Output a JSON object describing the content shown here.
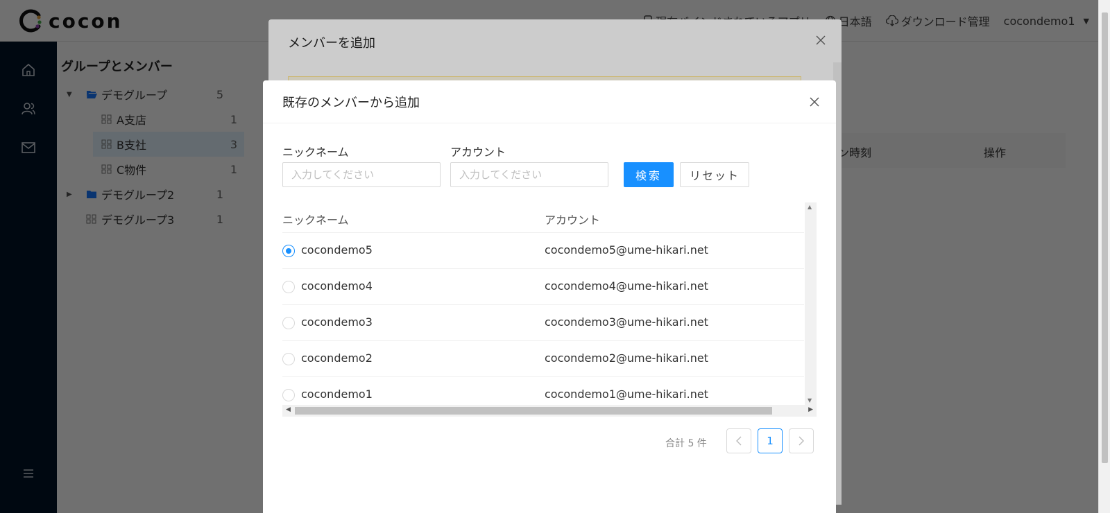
{
  "app": {
    "logo_text": "cocon",
    "header_links": [
      "現在バインドされているアプリ",
      "日本語",
      "ダウンロード管理"
    ],
    "user": "cocondemo1"
  },
  "tree": {
    "title": "グループとメンバー",
    "items": [
      {
        "label": "デモグループ",
        "count": "5"
      },
      {
        "label": "A支店",
        "count": "1"
      },
      {
        "label": "B支社",
        "count": "3"
      },
      {
        "label": "C物件",
        "count": "1"
      },
      {
        "label": "デモグループ2",
        "count": "1"
      },
      {
        "label": "デモグループ3",
        "count": "1"
      }
    ]
  },
  "background_table": {
    "col_login": "イン時刻",
    "col_ops": "操作"
  },
  "modal_add_member": {
    "title": "メンバーを追加"
  },
  "modal_existing": {
    "title": "既存のメンバーから追加",
    "nickname_label": "ニックネーム",
    "account_label": "アカウント",
    "nickname_placeholder": "入力してください",
    "account_placeholder": "入力してください",
    "search_label": "検索",
    "reset_label": "リセット",
    "table": {
      "headers": [
        "ニックネーム",
        "アカウント"
      ],
      "rows": [
        {
          "nickname": "cocondemo5",
          "account": "cocondemo5@ume-hikari.net",
          "selected": true
        },
        {
          "nickname": "cocondemo4",
          "account": "cocondemo4@ume-hikari.net",
          "selected": false
        },
        {
          "nickname": "cocondemo3",
          "account": "cocondemo3@ume-hikari.net",
          "selected": false
        },
        {
          "nickname": "cocondemo2",
          "account": "cocondemo2@ume-hikari.net",
          "selected": false
        },
        {
          "nickname": "cocondemo1",
          "account": "cocondemo1@ume-hikari.net",
          "selected": false
        }
      ]
    },
    "pagination": {
      "total_text": "合計 5 件",
      "current_page": "1"
    }
  },
  "colors": {
    "primary": "#1890ff",
    "sidebar": "#001529",
    "folder": "#1677ff"
  }
}
